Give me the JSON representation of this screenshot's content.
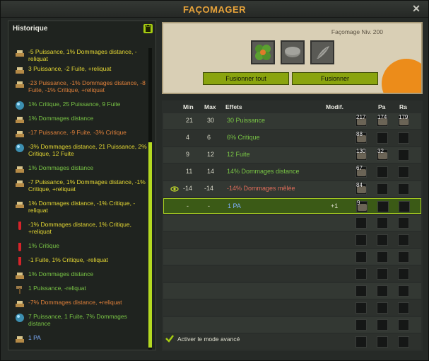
{
  "window": {
    "title": "FAÇOMAGER"
  },
  "history": {
    "title": "Historique",
    "items": [
      {
        "text": "-5 Puissance, 1% Dommages distance, -reliquat",
        "color": "yellow",
        "icon": "tools-icon"
      },
      {
        "text": "3 Puissance, -2 Fuite, +reliquat",
        "color": "yellow",
        "icon": "tools-icon"
      },
      {
        "text": "-23 Puissance, -1% Dommages distance, -8 Fuite, -1% Critique, +reliquat",
        "color": "orange",
        "icon": "tools-icon"
      },
      {
        "text": "1% Critique, 25 Puissance, 9 Fuite",
        "color": "green",
        "icon": "orb-icon"
      },
      {
        "text": "1% Dommages distance",
        "color": "green",
        "icon": "tools-icon"
      },
      {
        "text": "-17 Puissance, -9 Fuite, -3% Critique",
        "color": "orange",
        "icon": "tools-icon"
      },
      {
        "text": "-3% Dommages distance, 21 Puissance, 2% Critique, 12 Fuite",
        "color": "yellow",
        "icon": "orb-icon"
      },
      {
        "text": "1% Dommages distance",
        "color": "green",
        "icon": "tools-icon"
      },
      {
        "text": "-7 Puissance, 1% Dommages distance, -1% Critique, +reliquat",
        "color": "yellow",
        "icon": "tools-icon"
      },
      {
        "text": "1% Dommages distance, -1% Critique, -reliquat",
        "color": "yellow",
        "icon": "tools-icon"
      },
      {
        "text": "-1% Dommages distance, 1% Critique, +reliquat",
        "color": "yellow",
        "icon": "vial-icon"
      },
      {
        "text": "1% Critique",
        "color": "green",
        "icon": "vial-icon"
      },
      {
        "text": "-1 Fuite, 1% Critique, -reliquat",
        "color": "yellow",
        "icon": "vial-icon"
      },
      {
        "text": "1% Dommages distance",
        "color": "green",
        "icon": "tools-icon"
      },
      {
        "text": "1 Puissance, -reliquat",
        "color": "green",
        "icon": "hammer-icon"
      },
      {
        "text": "-7% Dommages distance, +reliquat",
        "color": "orange",
        "icon": "tools-icon"
      },
      {
        "text": "7 Puissance, 1 Fuite, 7% Dommages distance",
        "color": "green",
        "icon": "orb-icon"
      },
      {
        "text": "1 PA",
        "color": "blue",
        "icon": "tools-icon"
      }
    ]
  },
  "forge": {
    "level": "Façomage Niv. 200",
    "buttons": {
      "merge_all": "Fusionner tout",
      "merge": "Fusionner"
    }
  },
  "table": {
    "headers": {
      "min": "Min",
      "max": "Max",
      "effects": "Effets",
      "modif": "Modif.",
      "pa": "Pa",
      "ra": "Ra"
    },
    "rows": [
      {
        "min": "21",
        "max": "30",
        "effect": "30 Puissance",
        "color": "green",
        "modif": "",
        "runes": [
          "217",
          "174",
          "179"
        ],
        "eye": false
      },
      {
        "min": "4",
        "max": "6",
        "effect": "6% Critique",
        "color": "green",
        "modif": "",
        "runes": [
          "88",
          "",
          ""
        ],
        "eye": false
      },
      {
        "min": "9",
        "max": "12",
        "effect": "12 Fuite",
        "color": "green",
        "modif": "",
        "runes": [
          "130",
          "32",
          ""
        ],
        "eye": false
      },
      {
        "min": "11",
        "max": "14",
        "effect": "14% Dommages distance",
        "color": "green",
        "modif": "",
        "runes": [
          "67",
          "",
          ""
        ],
        "eye": false
      },
      {
        "min": "-14",
        "max": "-14",
        "effect": "-14% Dommages mêlée",
        "color": "red",
        "modif": "",
        "runes": [
          "84",
          "",
          ""
        ],
        "eye": true
      },
      {
        "min": "-",
        "max": "-",
        "effect": "1 PA",
        "color": "blue",
        "modif": "+1",
        "runes": [
          "9",
          "",
          ""
        ],
        "eye": false,
        "selected": true
      }
    ],
    "empty_rows": 8,
    "advanced_mode": {
      "label": "Activer le mode avancé",
      "checked": true
    }
  },
  "colors": {
    "accent": "#a6cc11",
    "title": "#e6a23a",
    "green": "#79c545",
    "yellow": "#e4d733",
    "orange": "#e0803a",
    "red": "#e06d5a",
    "blue": "#7fb0ff"
  }
}
